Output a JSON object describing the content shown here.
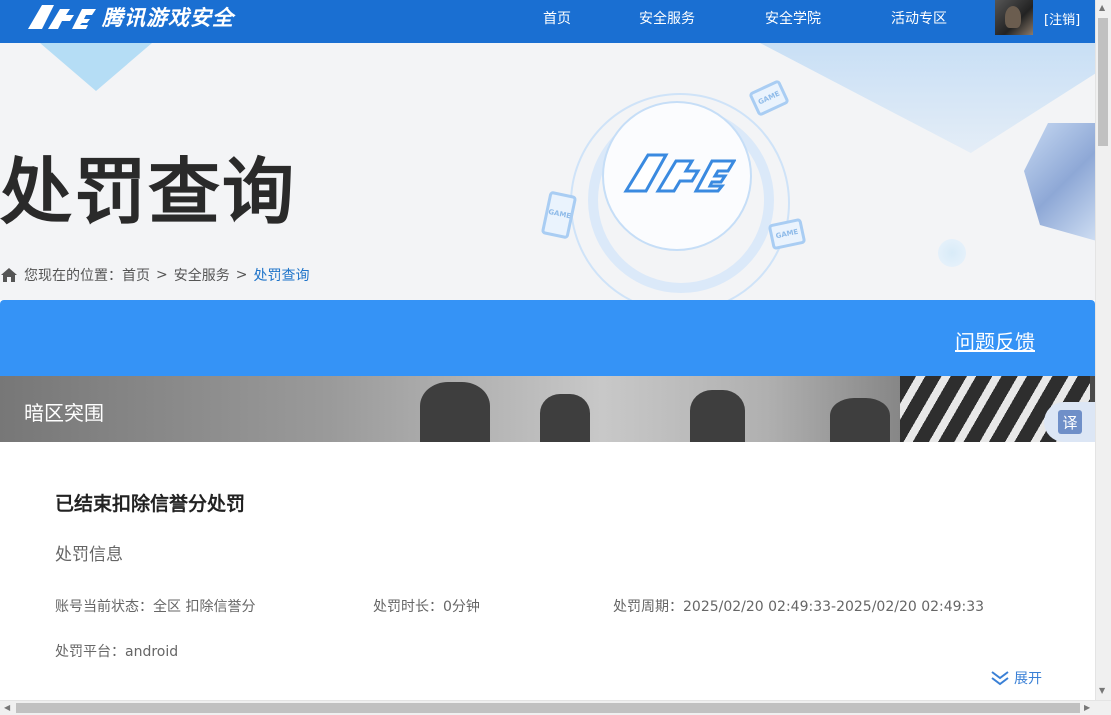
{
  "header": {
    "logo_text": "腾讯游戏安全",
    "nav": [
      "首页",
      "安全服务",
      "安全学院",
      "活动专区"
    ],
    "logout": "[注销]"
  },
  "hero": {
    "title": "处罚查询",
    "game_card_text": "GAME",
    "breadcrumb": {
      "prefix": "您现在的位置：",
      "items": [
        "首页",
        "安全服务"
      ],
      "separator": ">",
      "current": "处罚查询"
    }
  },
  "feedback_link": "问题反馈",
  "game_name": "暗区突围",
  "translate_label": "译",
  "penalty": {
    "status_title": "已结束扣除信誉分处罚",
    "section_label": "处罚信息",
    "fields": [
      {
        "label": "账号当前状态：",
        "value": "全区 扣除信誉分"
      },
      {
        "label": "处罚时长：",
        "value": "0分钟"
      },
      {
        "label": "处罚周期：",
        "value": "2025/02/20 02:49:33-2025/02/20 02:49:33"
      },
      {
        "label": "处罚平台：",
        "value": "android"
      }
    ],
    "expand_label": "展开"
  },
  "colors": {
    "header_blue": "#1a6fd2",
    "bar_blue": "#3593f6",
    "link_blue": "#1f74c9"
  }
}
